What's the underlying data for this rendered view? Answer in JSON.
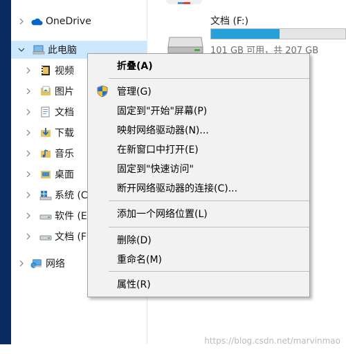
{
  "nav_tree": {
    "items": [
      {
        "label": "OneDrive",
        "icon": "cloud-icon"
      },
      {
        "label": "此电脑",
        "icon": "computer-icon"
      },
      {
        "label": "视频",
        "icon": "videos-folder-icon"
      },
      {
        "label": "图片",
        "icon": "pictures-folder-icon"
      },
      {
        "label": "文档",
        "icon": "documents-folder-icon"
      },
      {
        "label": "下载",
        "icon": "downloads-folder-icon"
      },
      {
        "label": "音乐",
        "icon": "music-folder-icon"
      },
      {
        "label": "桌面",
        "icon": "desktop-folder-icon"
      },
      {
        "label": "系统 (C",
        "icon": "system-drive-icon"
      },
      {
        "label": "软件 (E",
        "icon": "drive-icon"
      },
      {
        "label": "文档 (F",
        "icon": "drive-icon"
      },
      {
        "label": "网络",
        "icon": "network-icon"
      }
    ]
  },
  "drive": {
    "title": "文档 (F:)",
    "space": "101 GB 可用，共 207 GB",
    "used_fraction": 0.51,
    "bar_color": "#26a0da"
  },
  "context_menu": {
    "items": [
      {
        "label": "折叠(A)",
        "bold": true
      },
      {
        "label": "管理(G)",
        "icon": "uac-shield-icon"
      },
      {
        "label": "固定到\"开始\"屏幕(P)"
      },
      {
        "label": "映射网络驱动器(N)..."
      },
      {
        "label": "在新窗口中打开(E)"
      },
      {
        "label": "固定到\"快速访问\""
      },
      {
        "label": "断开网络驱动器的连接(C)..."
      },
      {
        "label": "添加一个网络位置(L)"
      },
      {
        "label": "删除(D)"
      },
      {
        "label": "重命名(M)"
      },
      {
        "label": "属性(R)"
      }
    ]
  },
  "watermark": "https://blog.csdn.net/marvinmao",
  "colors": {
    "selected_bg": "#cce8ff",
    "desktop_strip": "#0a2a63"
  }
}
